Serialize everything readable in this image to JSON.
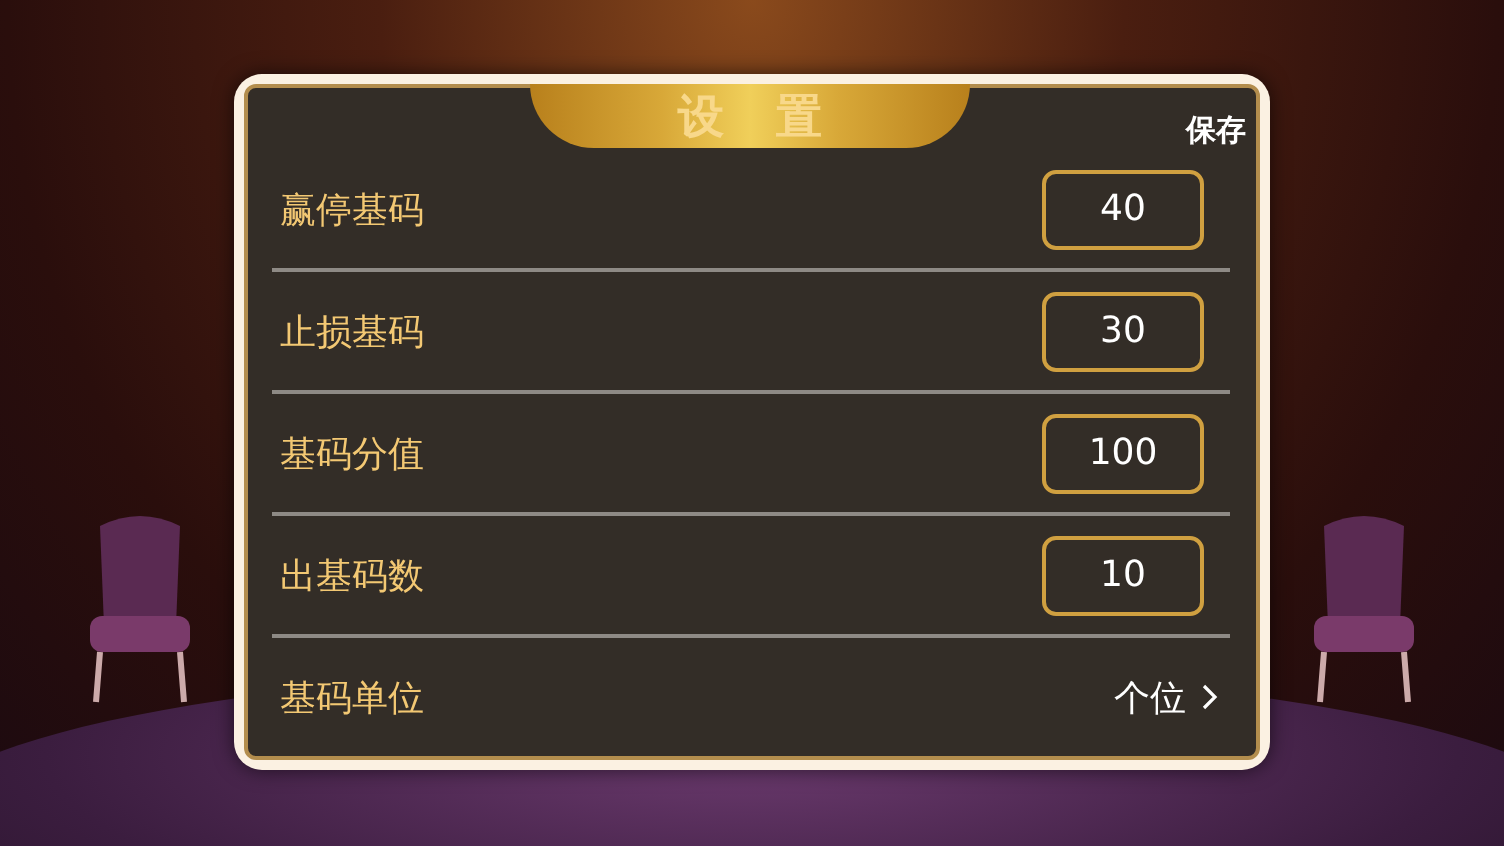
{
  "dialog": {
    "title": "设置",
    "save": "保存",
    "rows": [
      {
        "kind": "input",
        "label": "赢停基码",
        "value": "40"
      },
      {
        "kind": "input",
        "label": "止损基码",
        "value": "30"
      },
      {
        "kind": "input",
        "label": "基码分值",
        "value": "100"
      },
      {
        "kind": "input",
        "label": "出基码数",
        "value": "10"
      },
      {
        "kind": "select",
        "label": "基码单位",
        "value": "个位"
      }
    ]
  }
}
